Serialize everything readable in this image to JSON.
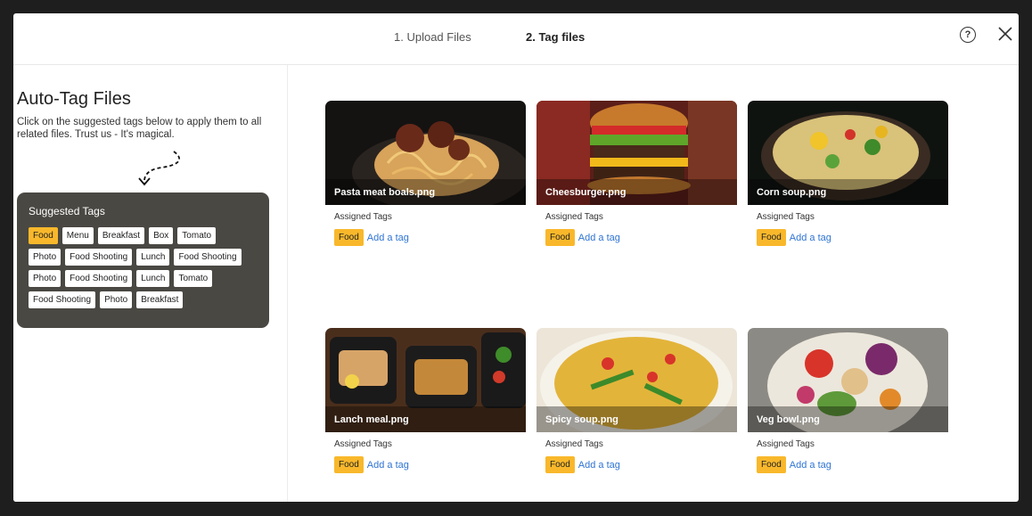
{
  "header": {
    "step1": "1. Upload Files",
    "step2": "2. Tag files",
    "help_icon": "?"
  },
  "sidebar": {
    "title": "Auto-Tag Files",
    "description": "Click on the suggested tags below to apply them to all related files. Trust us - It's magical.",
    "suggested_title": "Suggested Tags",
    "rows": [
      [
        "Food",
        "Menu",
        "Breakfast",
        "Box",
        "Tomato"
      ],
      [
        "Photo",
        "Food Shooting",
        "Lunch",
        "Food Shooting"
      ],
      [
        "Photo",
        "Food Shooting",
        "Lunch",
        "Tomato"
      ],
      [
        "Food Shooting",
        "Photo",
        "Breakfast"
      ]
    ],
    "active_tag": "Food"
  },
  "cards": [
    {
      "filename": "Pasta meat boals.png",
      "assigned_label": "Assigned Tags",
      "tag": "Food",
      "add_tag": "Add a tag"
    },
    {
      "filename": "Cheesburger.png",
      "assigned_label": "Assigned Tags",
      "tag": "Food",
      "add_tag": "Add a tag"
    },
    {
      "filename": "Corn soup.png",
      "assigned_label": "Assigned Tags",
      "tag": "Food",
      "add_tag": "Add a tag"
    },
    {
      "filename": "Lanch meal.png",
      "assigned_label": "Assigned Tags",
      "tag": "Food",
      "add_tag": "Add a tag"
    },
    {
      "filename": "Spicy soup.png",
      "assigned_label": "Assigned Tags",
      "tag": "Food",
      "add_tag": "Add a tag"
    },
    {
      "filename": "Veg bowl.png",
      "assigned_label": "Assigned Tags",
      "tag": "Food",
      "add_tag": "Add a tag"
    }
  ],
  "colors": {
    "accent": "#f9b82b",
    "link": "#2f74d4",
    "panel": "#4a4843"
  }
}
